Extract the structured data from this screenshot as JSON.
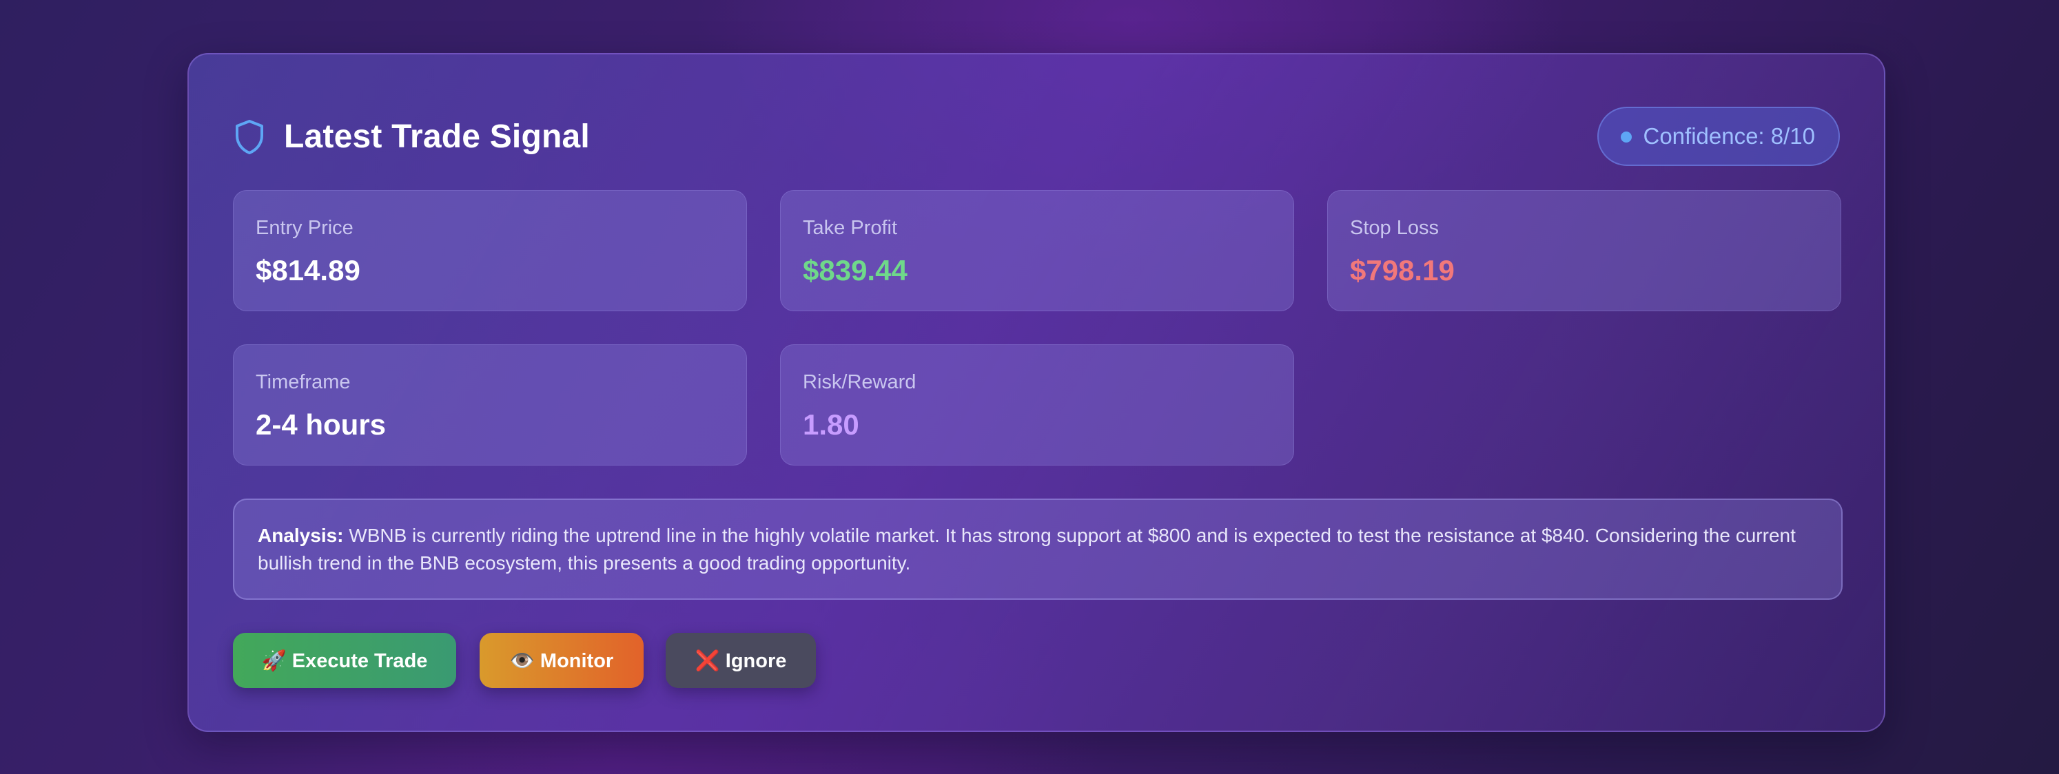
{
  "signal": {
    "title": "Latest Trade Signal",
    "confidence_label": "Confidence: 8/10",
    "metrics": [
      {
        "label": "Entry Price",
        "value": "$814.89"
      },
      {
        "label": "Take Profit",
        "value": "$839.44"
      },
      {
        "label": "Stop Loss",
        "value": "$798.19"
      },
      {
        "label": "Timeframe",
        "value": "2-4 hours"
      },
      {
        "label": "Risk/Reward",
        "value": "1.80"
      }
    ],
    "analysis_heading": "Analysis:",
    "analysis_text": " WBNB is currently riding the uptrend line in the highly volatile market. It has strong support at $800 and is expected to test the resistance at $840. Considering the current bullish trend in the BNB ecosystem, this presents a good trading opportunity."
  },
  "actions": {
    "execute": {
      "icon": "🚀",
      "label": "Execute Trade"
    },
    "monitor": {
      "icon": "👁️",
      "label": "Monitor"
    },
    "ignore": {
      "icon": "❌",
      "label": "Ignore"
    }
  },
  "icons": {
    "header": "shield-icon",
    "badge": "status-dot-icon"
  },
  "colors": {
    "take_profit": "#6fd88a",
    "stop_loss": "#f2787a",
    "risk_reward": "#c79cff",
    "accent_blue": "#5ea6f5"
  }
}
